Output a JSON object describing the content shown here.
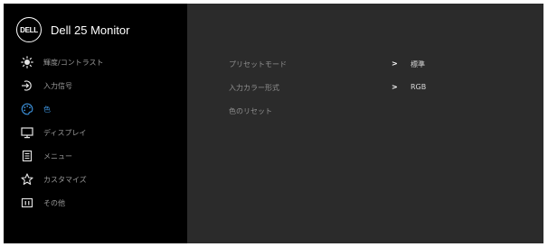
{
  "header": {
    "logo_text": "DELL",
    "title": "Dell 25 Monitor"
  },
  "sidebar": {
    "items": [
      {
        "label": "輝度/コントラスト",
        "icon": "brightness-icon"
      },
      {
        "label": "入力信号",
        "icon": "input-source-icon"
      },
      {
        "label": "色",
        "icon": "color-palette-icon",
        "active": true
      },
      {
        "label": "ディスプレイ",
        "icon": "display-icon"
      },
      {
        "label": "メニュー",
        "icon": "menu-icon"
      },
      {
        "label": "カスタマイズ",
        "icon": "star-icon"
      },
      {
        "label": "その他",
        "icon": "info-icon"
      }
    ]
  },
  "main": {
    "rows": [
      {
        "label": "プリセットモード",
        "value": "標準"
      },
      {
        "label": "入力カラー形式",
        "value": "RGB"
      },
      {
        "label": "色のリセット"
      }
    ],
    "arrow_glyph": ">"
  },
  "colors": {
    "accent": "#3b8fd8",
    "panel": "#2b2b2b",
    "sidebar": "#000000"
  }
}
